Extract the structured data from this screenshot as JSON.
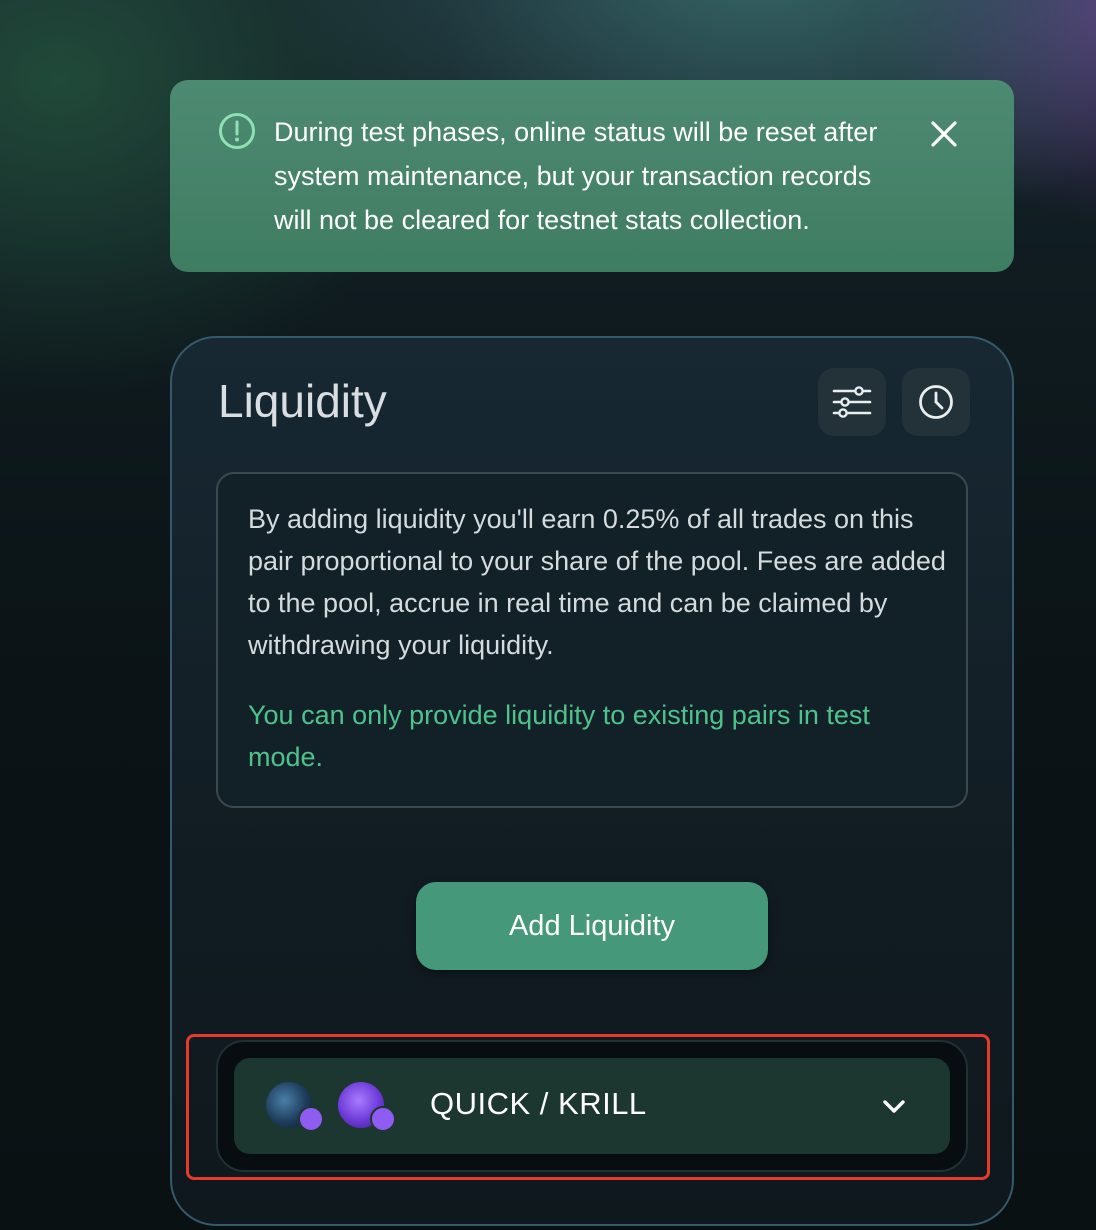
{
  "banner": {
    "icon": "alert-circle-icon",
    "message": "During test phases, online status will be reset after system maintenance, but your transaction records will not be cleared for testnet stats collection.",
    "close_icon": "close-icon",
    "background_color": "#3f7d62"
  },
  "liquidity": {
    "title": "Liquidity",
    "settings_icon": "sliders-icon",
    "history_icon": "clock-icon",
    "info_text": "By adding liquidity you'll earn 0.25% of all trades on this pair proportional to your share of the pool. Fees are added to the pool, accrue in real time and can be claimed by withdrawing your liquidity.",
    "info_note": "You can only provide liquidity to existing pairs in test mode.",
    "add_button_label": "Add Liquidity",
    "accent_color": "#45987a",
    "note_color": "#4fc28c"
  },
  "pair_selector": {
    "label": "QUICK / KRILL",
    "tokens": [
      "QUICK",
      "KRILL"
    ],
    "chain_badge_icon": "polygon-icon",
    "expand_icon": "chevron-down-icon",
    "highlight_color": "#e53b2c"
  }
}
